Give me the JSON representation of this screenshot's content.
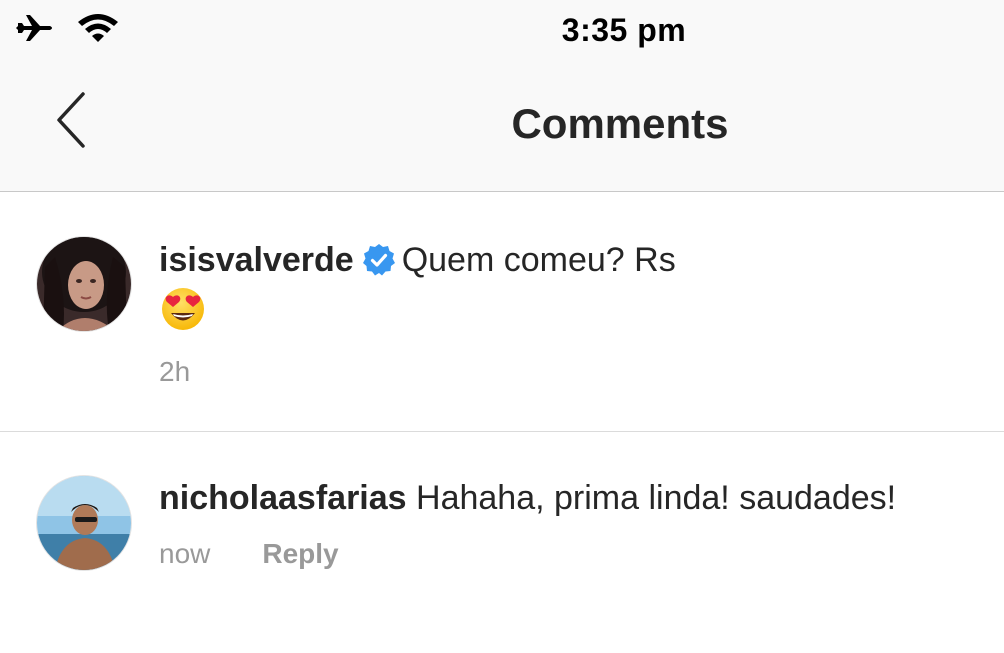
{
  "status_bar": {
    "time": "3:35 pm",
    "icons": [
      "airplane-icon",
      "wifi-icon"
    ]
  },
  "nav": {
    "title": "Comments",
    "back_icon": "chevron-left-icon"
  },
  "comments": [
    {
      "username": "isisvalverde",
      "verified": true,
      "text": "Quem comeu? Rs",
      "emoji": "heart-eyes-emoji",
      "time": "2h"
    },
    {
      "username": "nicholaasfarias",
      "verified": false,
      "text": "Hahaha, prima linda! saudades!",
      "time": "now",
      "reply_label": "Reply"
    }
  ],
  "colors": {
    "text": "#262626",
    "meta": "#999999",
    "bar_background": "#f9f9f9",
    "verified_badge": "#3897f0"
  }
}
